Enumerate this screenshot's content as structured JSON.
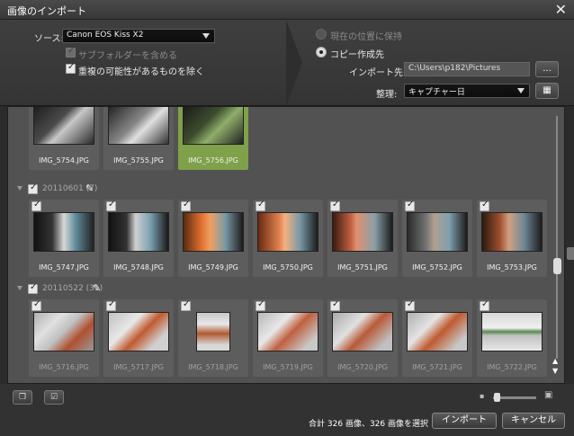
{
  "window": {
    "title": "画像のインポート"
  },
  "options": {
    "source_label": "ソース:",
    "source_value": "Canon EOS Kiss X2",
    "include_subfolders": "サブフォルダーを含める",
    "exclude_duplicates": "重複の可能性があるものを除く",
    "keep_location": "現在の位置に保持",
    "copy_to": "コピー作成先",
    "import_dest_label": "インポート先:",
    "import_dest_value": "C:\\Users\\p182\\Pictures",
    "browse_button": "...",
    "organize_label": "整理:",
    "organize_value": "キャプチャー日"
  },
  "groups": [
    {
      "header": "",
      "thumbs": [
        {
          "name": "IMG_5754.JPG",
          "selected": false
        },
        {
          "name": "IMG_5755.JPG",
          "selected": false
        },
        {
          "name": "IMG_5756.JPG",
          "selected": true
        }
      ]
    },
    {
      "header": "20110601 (7)",
      "thumbs": [
        {
          "name": "IMG_5747.JPG"
        },
        {
          "name": "IMG_5748.JPG"
        },
        {
          "name": "IMG_5749.JPG"
        },
        {
          "name": "IMG_5750.JPG"
        },
        {
          "name": "IMG_5751.JPG"
        },
        {
          "name": "IMG_5752.JPG"
        },
        {
          "name": "IMG_5753.JPG"
        }
      ]
    },
    {
      "header": "20110522 (31)",
      "thumbs": [
        {
          "name": "IMG_5716.JPG"
        },
        {
          "name": "IMG_5717.JPG"
        },
        {
          "name": "IMG_5718.JPG"
        },
        {
          "name": "IMG_5719.JPG"
        },
        {
          "name": "IMG_5720.JPG"
        },
        {
          "name": "IMG_5721.JPG"
        },
        {
          "name": "IMG_5722.JPG"
        }
      ]
    }
  ],
  "footer": {
    "status": "合計 326 画像、326 画像を選択",
    "import_button": "インポート",
    "cancel_button": "キャンセル"
  },
  "colors": {
    "selected_thumb": "#7ea14a",
    "panel": "#525252",
    "chrome": "#323232"
  }
}
